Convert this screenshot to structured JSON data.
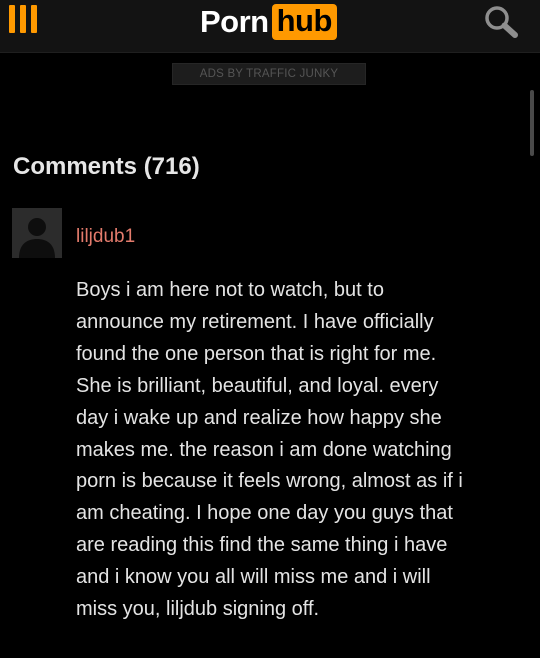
{
  "header": {
    "logo_part1": "Porn",
    "logo_part2": "hub",
    "accent_color": "#ff9900",
    "menu_icon": "hamburger-menu-icon",
    "search_icon": "search-icon"
  },
  "ads": {
    "label": "ADS BY TRAFFIC JUNKY"
  },
  "comments": {
    "title": "Comments (716)",
    "items": [
      {
        "username": "liljdub1",
        "avatar_icon": "default-user-avatar-icon",
        "body_lines": [
          "Boys i am here not to watch, but to",
          "announce my retirement. I have officially",
          "found the one person that is right for me.",
          "She is brilliant, beautiful, and loyal. every",
          "day i wake up and realize how happy she",
          "makes me. the reason i am done watching",
          "porn is because it feels wrong, almost as if i",
          "am cheating. I hope one day you guys that",
          "are reading this find the same thing i have",
          "and i know you all will miss me and i will",
          "miss you, liljdub signing off."
        ]
      }
    ]
  }
}
